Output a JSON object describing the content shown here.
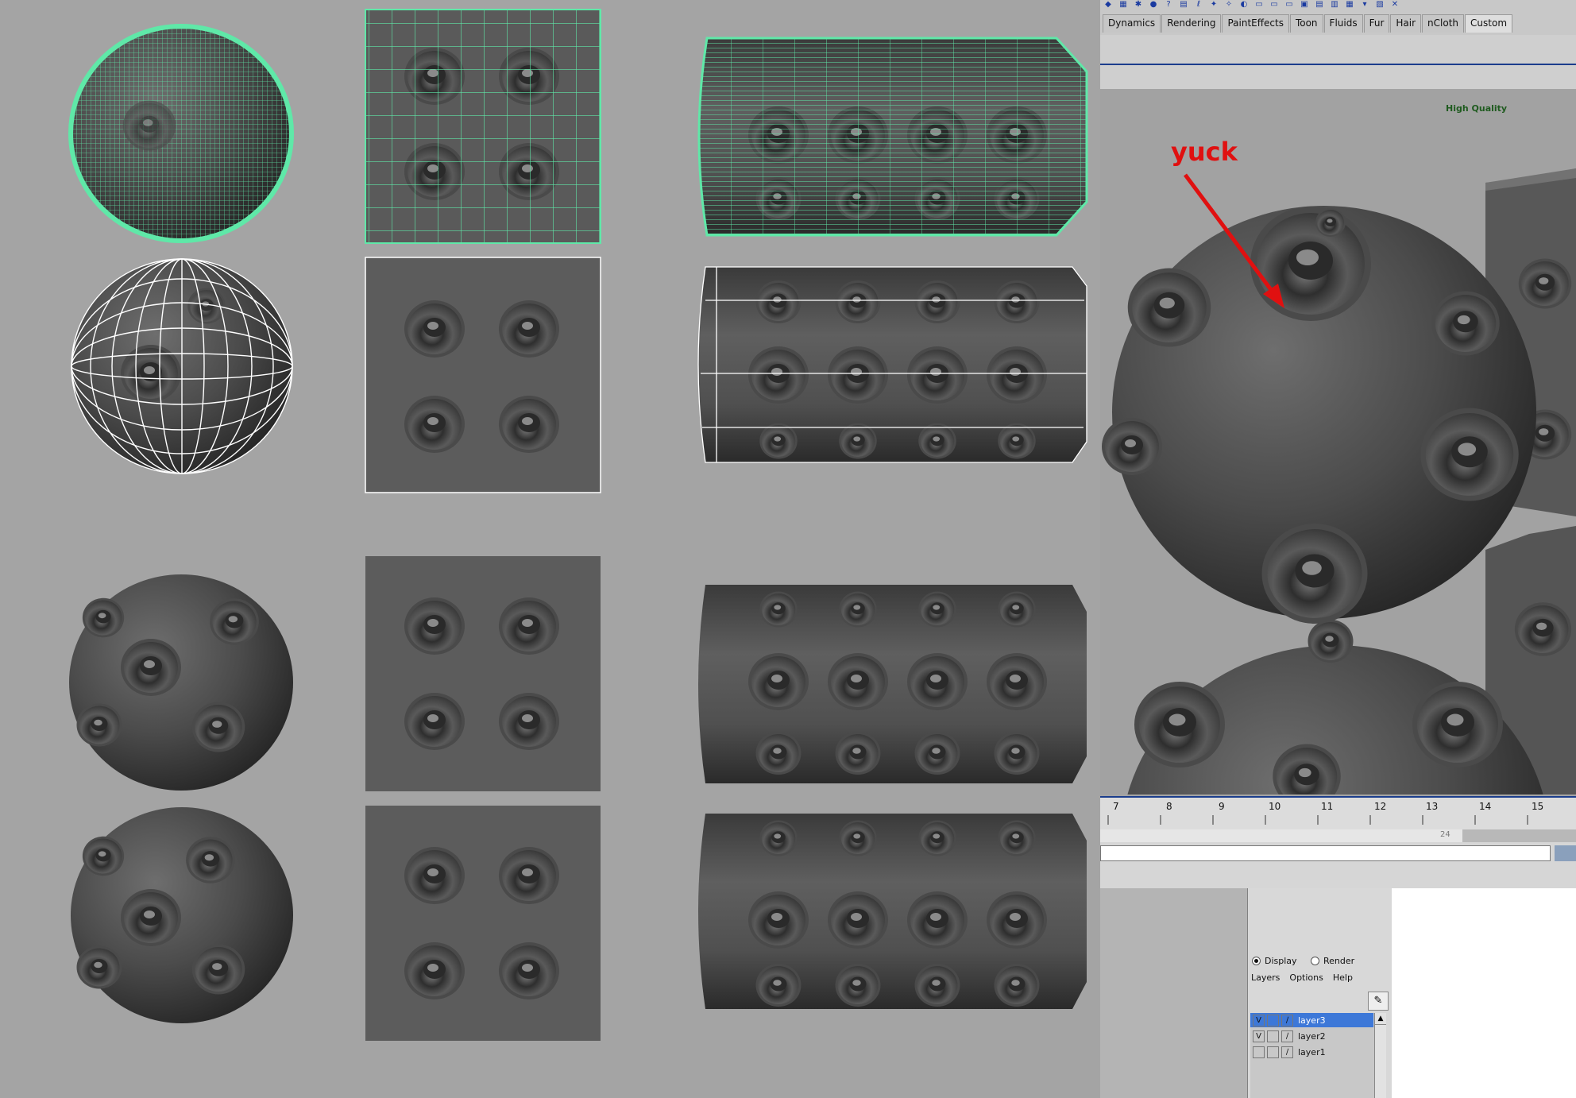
{
  "shelf": {
    "tabs": [
      "Dynamics",
      "Rendering",
      "PaintEffects",
      "Toon",
      "Fluids",
      "Fur",
      "Hair",
      "nCloth",
      "Custom"
    ],
    "active_tab": "Custom"
  },
  "viewport": {
    "quality_label": "High Quality",
    "annotation": "yuck",
    "annotation_color": "#e01010"
  },
  "timeline": {
    "ticks": [
      "7",
      "8",
      "9",
      "10",
      "11",
      "12",
      "13",
      "14",
      "15"
    ],
    "range_value": "24"
  },
  "layer_editor": {
    "modes": {
      "display": "Display",
      "render": "Render",
      "selected": "Display"
    },
    "menu": [
      "Layers",
      "Options",
      "Help"
    ],
    "layers": [
      {
        "visible": "V",
        "name": "layer3",
        "selected": true
      },
      {
        "visible": "V",
        "name": "layer2",
        "selected": false
      },
      {
        "visible": "",
        "name": "layer1",
        "selected": false
      }
    ]
  },
  "colors": {
    "background": "#a4a4a4",
    "wireframe_highlight": "#5fe8a8",
    "wireframe_white": "#ffffff",
    "selection_blue": "#3d78d8"
  }
}
